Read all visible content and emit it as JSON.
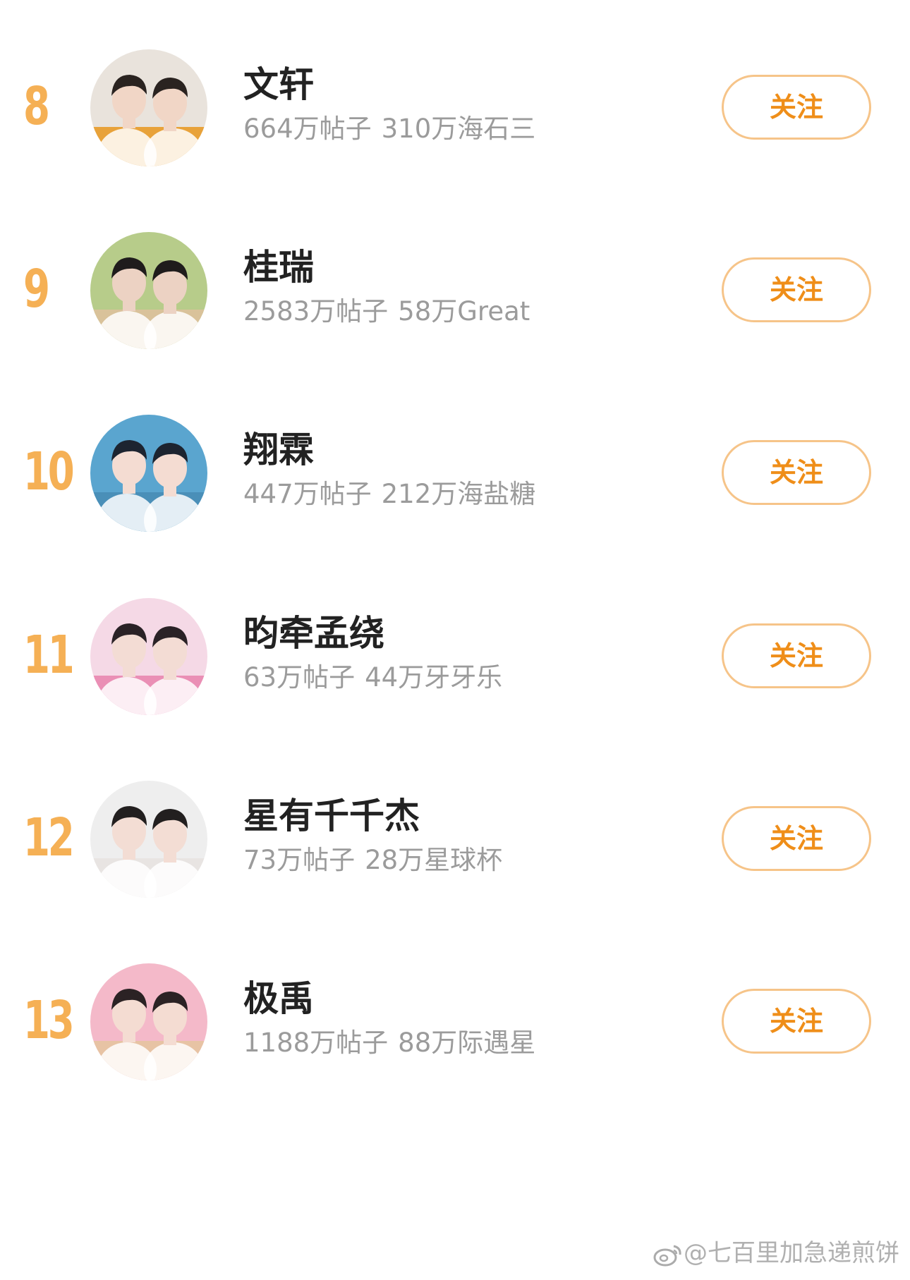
{
  "rows": [
    {
      "rank": "8",
      "title": "文轩",
      "posts": "664万帖子",
      "fans": "310万海石三",
      "follow_label": "关注",
      "avatar": {
        "bg": "#e9e3dc",
        "accent": "#e8a23a",
        "hair": "#2a2320",
        "skin": "#f1d6c6",
        "icon": "duo-portrait-avatar"
      }
    },
    {
      "rank": "9",
      "title": "桂瑞",
      "posts": "2583万帖子",
      "fans": "58万Great",
      "follow_label": "关注",
      "avatar": {
        "bg": "#b7cc8a",
        "accent": "#d9c29a",
        "hair": "#1f1c1c",
        "skin": "#ecd2c3",
        "icon": "duo-portrait-avatar"
      }
    },
    {
      "rank": "10",
      "title": "翔霖",
      "posts": "447万帖子",
      "fans": "212万海盐糖",
      "follow_label": "关注",
      "avatar": {
        "bg": "#5aa5cf",
        "accent": "#4a8fb8",
        "hair": "#1d2430",
        "skin": "#f4dcd2",
        "icon": "duo-portrait-avatar"
      }
    },
    {
      "rank": "11",
      "title": "昀牵孟绕",
      "posts": "63万帖子",
      "fans": "44万牙牙乐",
      "follow_label": "关注",
      "avatar": {
        "bg": "#f5d9e6",
        "accent": "#ea8fb5",
        "hair": "#2a2226",
        "skin": "#f3dcd4",
        "icon": "duo-portrait-avatar"
      }
    },
    {
      "rank": "12",
      "title": "星有千千杰",
      "posts": "73万帖子",
      "fans": "28万星球杯",
      "follow_label": "关注",
      "avatar": {
        "bg": "#eeeeee",
        "accent": "#e8e4e2",
        "hair": "#221f1f",
        "skin": "#f3ddd4",
        "icon": "duo-portrait-avatar"
      }
    },
    {
      "rank": "13",
      "title": "极禹",
      "posts": "1188万帖子",
      "fans": "88万际遇星",
      "follow_label": "关注",
      "avatar": {
        "bg": "#f4b9c9",
        "accent": "#e7c3a4",
        "hair": "#2b2224",
        "skin": "#f4dcd2",
        "icon": "duo-portrait-avatar"
      }
    }
  ],
  "colors": {
    "rank": "#f5b055",
    "button_border": "#f6c489",
    "button_text": "#ef8e19",
    "title": "#222222",
    "stats": "#9b9b9b"
  },
  "watermark": {
    "text": "@七百里加急递煎饼",
    "icon": "weibo-logo-icon"
  }
}
